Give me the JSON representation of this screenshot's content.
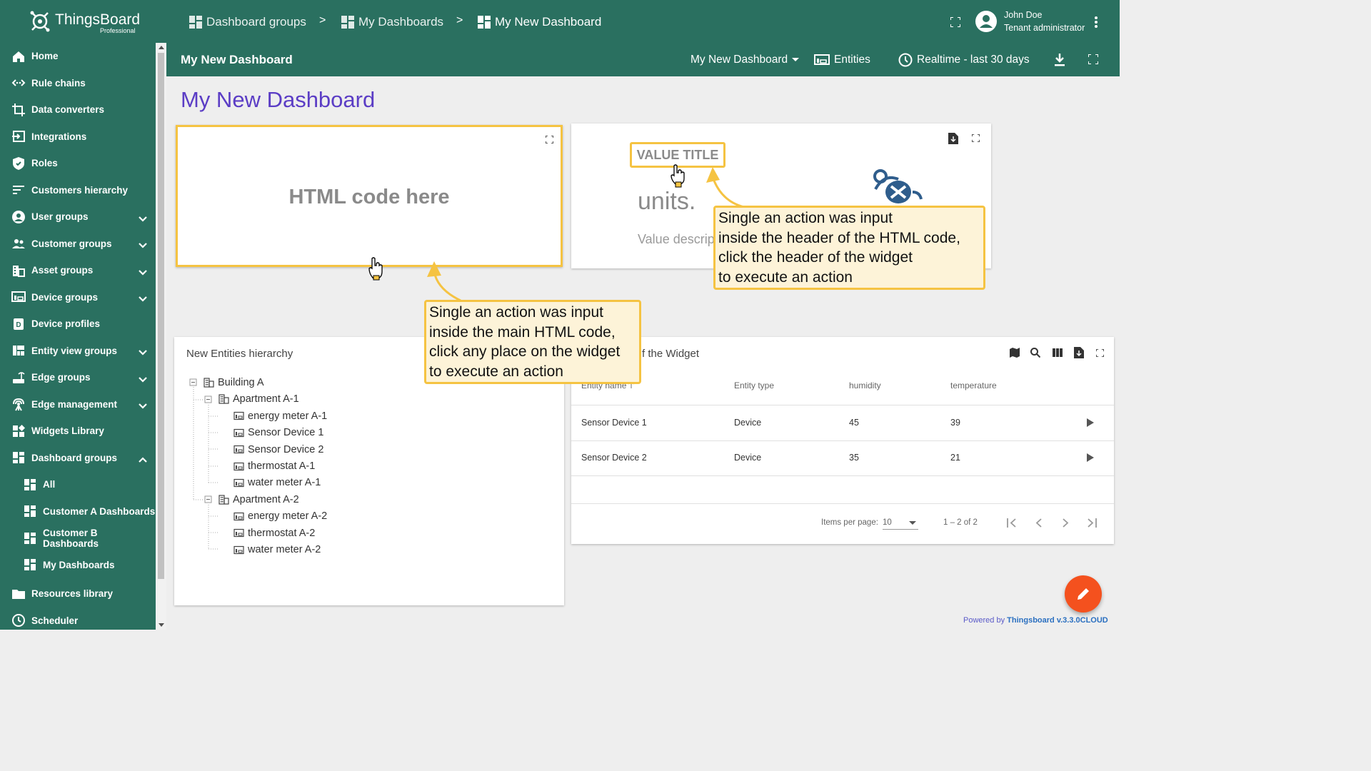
{
  "app": {
    "brand": "ThingsBoard",
    "brand_sub": "Professional"
  },
  "breadcrumb": [
    {
      "label": "Dashboard groups"
    },
    {
      "label": "My Dashboards"
    },
    {
      "label": "My New Dashboard"
    }
  ],
  "breadcrumb_sep": ">",
  "user": {
    "name": "John Doe",
    "role": "Tenant administrator"
  },
  "toolbar": {
    "title": "My New Dashboard",
    "dashboard_select": "My New Dashboard",
    "entities_label": "Entities",
    "timewindow_label": "Realtime - last 30 days"
  },
  "sidebar": {
    "items": [
      {
        "label": "Home",
        "icon": "home-icon"
      },
      {
        "label": "Rule chains",
        "icon": "rule-chains-icon"
      },
      {
        "label": "Data converters",
        "icon": "crop-icon"
      },
      {
        "label": "Integrations",
        "icon": "input-icon"
      },
      {
        "label": "Roles",
        "icon": "shield-icon"
      },
      {
        "label": "Customers hierarchy",
        "icon": "sort-icon"
      },
      {
        "label": "User groups",
        "icon": "account-icon",
        "expandable": true
      },
      {
        "label": "Customer groups",
        "icon": "supervisor-icon",
        "expandable": true
      },
      {
        "label": "Asset groups",
        "icon": "domain-icon",
        "expandable": true
      },
      {
        "label": "Device groups",
        "icon": "devices-icon",
        "expandable": true
      },
      {
        "label": "Device profiles",
        "icon": "device-profile-icon"
      },
      {
        "label": "Entity view groups",
        "icon": "view-quilt-icon",
        "expandable": true
      },
      {
        "label": "Edge groups",
        "icon": "router-icon",
        "expandable": true
      },
      {
        "label": "Edge management",
        "icon": "settings-input-antenna-icon",
        "expandable": true
      },
      {
        "label": "Widgets Library",
        "icon": "widgets-icon"
      },
      {
        "label": "Dashboard groups",
        "icon": "dashboard-icon",
        "expandable": true,
        "expanded": true
      },
      {
        "label": "All",
        "icon": "dashboard-icon",
        "sub": true
      },
      {
        "label": "Customer A Dashboards",
        "icon": "dashboard-icon",
        "sub": true
      },
      {
        "label": "Customer B Dashboards",
        "icon": "dashboard-icon",
        "sub": true
      },
      {
        "label": "My Dashboards",
        "icon": "dashboard-icon",
        "sub": true
      },
      {
        "label": "Resources library",
        "icon": "folder-icon"
      },
      {
        "label": "Scheduler",
        "icon": "schedule-icon"
      }
    ]
  },
  "page_title": "My New Dashboard",
  "html_widget": {
    "text": "HTML code here"
  },
  "value_widget": {
    "title": "VALUE TITLE",
    "units": "units.",
    "description": "Value descrip"
  },
  "hierarchy_widget": {
    "title": "New Entities hierarchy",
    "nodes": [
      {
        "label": "Building A",
        "level": 0,
        "type": "asset"
      },
      {
        "label": "Apartment A-1",
        "level": 1,
        "type": "asset"
      },
      {
        "label": "energy meter A-1",
        "level": 2,
        "type": "device"
      },
      {
        "label": "Sensor Device 1",
        "level": 2,
        "type": "device"
      },
      {
        "label": "Sensor Device 2",
        "level": 2,
        "type": "device"
      },
      {
        "label": "thermostat A-1",
        "level": 2,
        "type": "device"
      },
      {
        "label": "water meter A-1",
        "level": 2,
        "type": "device"
      },
      {
        "label": "Apartment A-2",
        "level": 1,
        "type": "asset"
      },
      {
        "label": "energy meter A-2",
        "level": 2,
        "type": "device"
      },
      {
        "label": "thermostat A-2",
        "level": 2,
        "type": "device"
      },
      {
        "label": "water meter A-2",
        "level": 2,
        "type": "device"
      }
    ]
  },
  "table_widget": {
    "title": "f the Widget",
    "columns": [
      "Entity name",
      "Entity type",
      "humidity",
      "temperature"
    ],
    "rows": [
      [
        "Sensor Device 1",
        "Device",
        "45",
        "39"
      ],
      [
        "Sensor Device 2",
        "Device",
        "35",
        "21"
      ]
    ],
    "items_per_page_label": "Items per page:",
    "items_per_page": "10",
    "range": "1 – 2 of 2"
  },
  "callouts": {
    "header": [
      "Single an action was input",
      "inside the header of the HTML code,",
      "click the header of the widget",
      "to execute an action"
    ],
    "main": [
      "Single an action was input",
      "inside the main HTML code,",
      "click any place on the widget",
      "to execute an action"
    ]
  },
  "footer": {
    "powered_prefix": "Powered by ",
    "powered_link": "Thingsboard v.3.3.0CLOUD"
  },
  "colors": {
    "primary": "#2a7060",
    "accent_title": "#5b3dc5",
    "highlight": "#f5c342",
    "fab": "#f4511e"
  }
}
